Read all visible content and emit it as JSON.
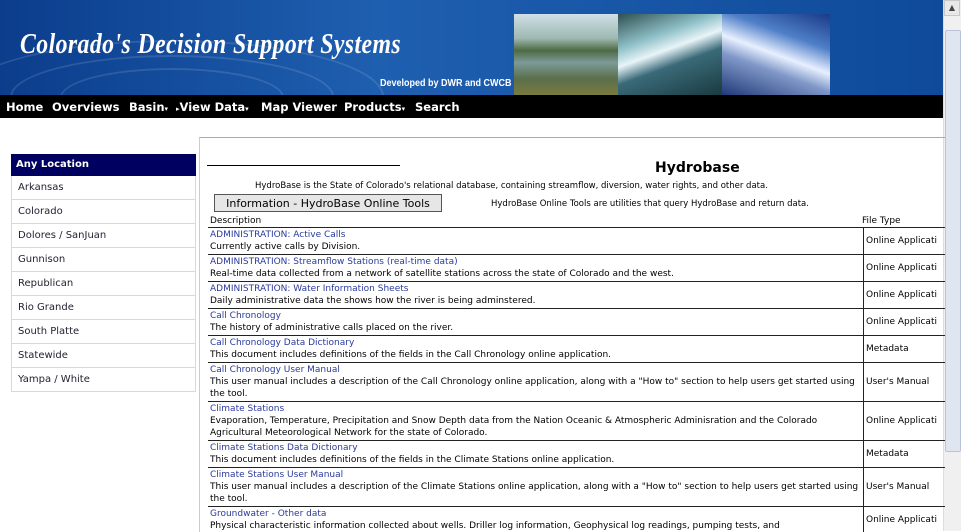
{
  "banner": {
    "title": "Colorado's Decision Support Systems",
    "subtitle": "Developed by DWR and CWCB"
  },
  "nav": {
    "home": "Home",
    "overviews": "Overviews",
    "basin": "Basin",
    "view_data": "View Data",
    "map_viewer": "Map Viewer",
    "products": "Products",
    "search": "Search"
  },
  "sidebar": {
    "header": "Any Location",
    "items": [
      "Arkansas",
      "Colorado",
      "Dolores / SanJuan",
      "Gunnison",
      "Republican",
      "Rio Grande",
      "South Platte",
      "Statewide",
      "Yampa / White"
    ]
  },
  "content": {
    "title": "Hydrobase",
    "intro": "HydroBase is the State of Colorado's relational database, containing streamflow, diversion, water rights, and other data.",
    "info_button": "Information - HydroBase Online Tools",
    "tools_note": "HydroBase Online Tools are utilities that query HydroBase and return data.",
    "col_description": "Description",
    "col_filetype": "File Type",
    "rows": [
      {
        "title": "ADMINISTRATION: Active Calls",
        "desc": "Currently active calls by Division.",
        "type": "Online Applicati"
      },
      {
        "title": "ADMINISTRATION: Streamflow Stations (real-time data)",
        "desc": "Real-time data collected from a network of satellite stations across the state of Colorado and the west.",
        "type": "Online Applicati"
      },
      {
        "title": "ADMINISTRATION: Water Information Sheets",
        "desc": "Daily administrative data the shows how the river is being adminstered.",
        "type": "Online Applicati"
      },
      {
        "title": "Call Chronology",
        "desc": "The history of administrative calls placed on the river.",
        "type": "Online Applicati"
      },
      {
        "title": "Call Chronology Data Dictionary",
        "desc": "This document includes definitions of the fields in the Call Chronology online application.",
        "type": "Metadata"
      },
      {
        "title": "Call Chronology User Manual",
        "desc": "This user manual includes a description of the Call Chronology online application, along with a \"How to\" section to help users get started using the tool.",
        "type": "User's Manual"
      },
      {
        "title": "Climate Stations",
        "desc": "Evaporation, Temperature, Precipitation and Snow Depth data from the Nation Oceanic & Atmospheric Adminisration and the Colorado Agricultural Meteorological Network for the state of Colorado.",
        "type": "Online Applicati"
      },
      {
        "title": "Climate Stations Data Dictionary",
        "desc": "This document includes definitions of the fields in the Climate Stations online application.",
        "type": "Metadata"
      },
      {
        "title": "Climate Stations User Manual",
        "desc": "This user manual includes a description of the Climate Stations online application, along with a \"How to\" section to help users get started using the tool.",
        "type": "User's Manual"
      },
      {
        "title": "Groundwater - Other data",
        "desc": "Physical characteristic information collected about wells. Driller log information, Geophysical log readings, pumping tests, and",
        "type": "Online Applicati"
      }
    ]
  }
}
